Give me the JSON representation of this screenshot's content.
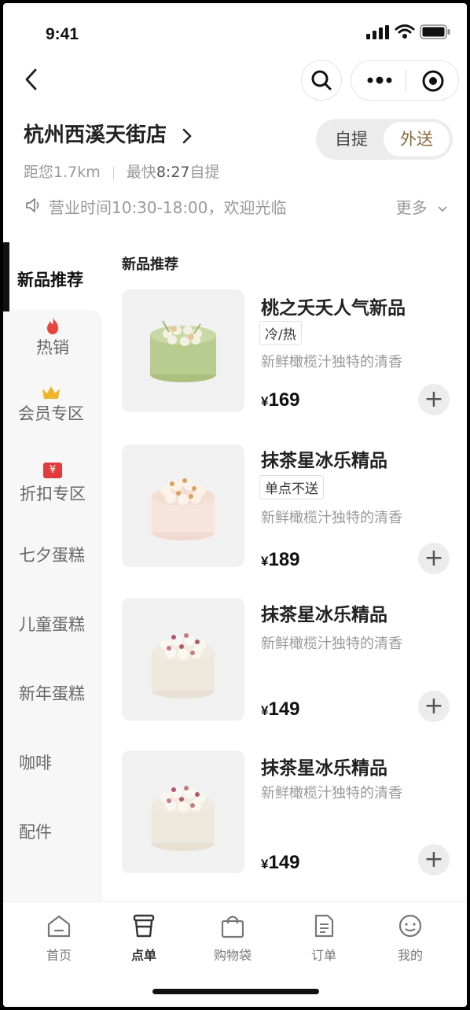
{
  "status_bar": {
    "time": "9:41"
  },
  "store": {
    "name": "杭州西溪天街店",
    "distance": "距您1.7km",
    "fastest_prefix": "最快",
    "fastest_time": "8:27",
    "fastest_suffix": "自提",
    "notice": "营业时间10:30-18:00，欢迎光临",
    "more_label": "更多"
  },
  "mode_toggle": {
    "pickup": "自提",
    "delivery": "外送",
    "selected": "外送"
  },
  "sidebar": {
    "items": [
      {
        "label": "新品推荐",
        "icon": ""
      },
      {
        "label": "热销",
        "icon": "flame-icon"
      },
      {
        "label": "会员专区",
        "icon": "crown-icon"
      },
      {
        "label": "折扣专区",
        "icon": "yen-coupon-icon"
      },
      {
        "label": "七夕蛋糕",
        "icon": ""
      },
      {
        "label": "儿童蛋糕",
        "icon": ""
      },
      {
        "label": "新年蛋糕",
        "icon": ""
      },
      {
        "label": "咖啡",
        "icon": ""
      },
      {
        "label": "配件",
        "icon": ""
      }
    ],
    "coupon_symbol": "¥",
    "active_index": 0
  },
  "section": {
    "title": "新品推荐"
  },
  "products": [
    {
      "name": "桃之夭夭人气新品",
      "tag": "冷/热",
      "desc": "新鲜橄榄汁独特的清香",
      "currency": "¥",
      "price": "169",
      "cake": "green"
    },
    {
      "name": "抹茶星冰乐精品",
      "tag": "单点不送",
      "desc": "新鲜橄榄汁独特的清香",
      "currency": "¥",
      "price": "189",
      "cake": "pink"
    },
    {
      "name": "抹茶星冰乐精品",
      "tag": "",
      "desc": "新鲜橄榄汁独特的清香",
      "currency": "¥",
      "price": "149",
      "cake": "white"
    },
    {
      "name": "抹茶星冰乐精品",
      "tag": "",
      "desc": "新鲜橄榄汁独特的清香",
      "currency": "¥",
      "price": "149",
      "cake": "white"
    }
  ],
  "tabbar": {
    "items": [
      {
        "label": "首页",
        "icon": "home-icon"
      },
      {
        "label": "点单",
        "icon": "cup-icon"
      },
      {
        "label": "购物袋",
        "icon": "bag-icon"
      },
      {
        "label": "订单",
        "icon": "order-icon"
      },
      {
        "label": "我的",
        "icon": "profile-icon"
      }
    ],
    "active": "点单"
  },
  "colors": {
    "accent": "#8a6a3c",
    "flame": "#e8453c",
    "crown": "#f0b429",
    "coupon": "#e23b3b"
  }
}
